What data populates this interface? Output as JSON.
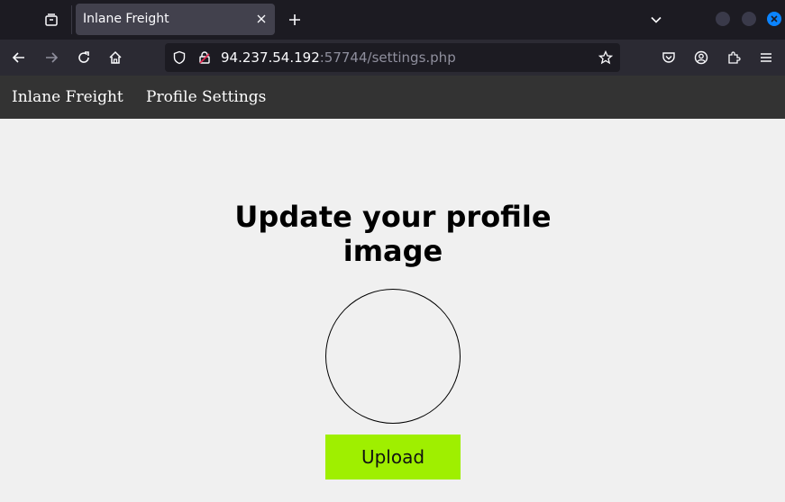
{
  "browser": {
    "tab_title": "Inlane Freight",
    "url_host": "94.237.54.192",
    "url_rest": ":57744/settings.php",
    "accent_color": "#0b84ff"
  },
  "site": {
    "brand": "Inlane Freight",
    "nav_link": "Profile Settings",
    "nav_bg": "#333333"
  },
  "main": {
    "heading": "Update your profile image",
    "upload_label": "Upload",
    "upload_color": "#9fef00"
  },
  "icons": {
    "tab_list": "tab-list-icon",
    "close": "close-icon",
    "new_tab": "plus-icon",
    "overflow": "chevron-down-icon",
    "back": "arrow-left-icon",
    "forward": "arrow-right-icon",
    "reload": "reload-icon",
    "home": "home-icon",
    "shield": "shield-icon",
    "lock": "lock-icon",
    "star": "star-icon",
    "pocket": "pocket-icon",
    "account": "account-icon",
    "extensions": "extensions-icon",
    "menu": "hamburger-menu-icon"
  }
}
